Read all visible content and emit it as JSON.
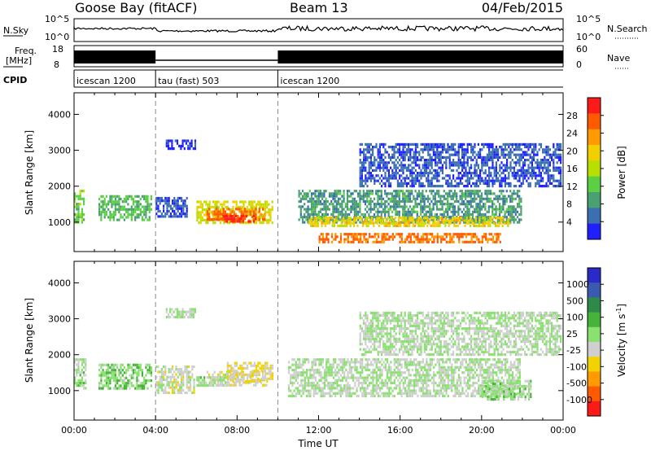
{
  "header": {
    "station": "Goose Bay (fitACF)",
    "beam": "Beam 13",
    "date": "04/Feb/2015"
  },
  "summary": {
    "nsky_label": "N.Sky",
    "nsearch_label": "N.Search",
    "freq_label_1": "Freq.",
    "freq_label_2": "[MHz]",
    "nave_label": "Nave",
    "cpid_label": "CPID",
    "nsky_ticks": [
      "10^5",
      "10^0"
    ],
    "nsearch_ticks": [
      "10^5",
      "10^0"
    ],
    "freq_ticks": [
      "18",
      "8"
    ],
    "nave_ticks": [
      "60",
      "0"
    ],
    "cpid_segments": [
      {
        "label": "icescan 1200",
        "start": 0,
        "end": 4
      },
      {
        "label": "tau (fast) 503",
        "start": 4,
        "end": 10
      },
      {
        "label": "icescan 1200",
        "start": 10,
        "end": 24
      }
    ]
  },
  "power_colorbar": {
    "title": "Power [dB]",
    "ticks": [
      "28",
      "24",
      "20",
      "16",
      "12",
      "8",
      "4"
    ],
    "colors": [
      "#ff1a1a",
      "#ff5a00",
      "#ff9a00",
      "#f2d000",
      "#b7e000",
      "#5bd044",
      "#4aa070",
      "#3a70b0",
      "#2020ff"
    ]
  },
  "velocity_colorbar": {
    "title": "Velocity [m s",
    "title_sup": "-1",
    "title_end": "]",
    "ticks": [
      "1000",
      "500",
      "100",
      "25",
      "-25",
      "-100",
      "-500",
      "-1000"
    ],
    "colors": [
      "#2a2ac8",
      "#3a5ab0",
      "#2f8a4a",
      "#46b43a",
      "#8ae070",
      "#cfcfcf",
      "#f2d200",
      "#ff9a00",
      "#ff5a00",
      "#ff1a1a"
    ]
  },
  "chart_data": [
    {
      "type": "heatmap",
      "panel": "power",
      "xlabel": "",
      "ylabel": "Slant Range [km]",
      "xlim": [
        0,
        24
      ],
      "ylim": [
        180,
        4600
      ],
      "ytick_labels": [
        "1000",
        "2000",
        "3000",
        "4000"
      ],
      "cpid_boundaries": [
        4,
        10
      ],
      "regions": [
        {
          "x0": 0.0,
          "x1": 0.6,
          "y0": 950,
          "y1": 1900,
          "v": 14
        },
        {
          "x0": 1.2,
          "x1": 3.9,
          "y0": 1000,
          "y1": 1750,
          "v": 12
        },
        {
          "x0": 4.0,
          "x1": 5.6,
          "y0": 1050,
          "y1": 1700,
          "v": 6
        },
        {
          "x0": 6.0,
          "x1": 9.8,
          "y0": 900,
          "y1": 1600,
          "v": 18
        },
        {
          "x0": 6.5,
          "x1": 9.4,
          "y0": 1000,
          "y1": 1400,
          "v": 26
        },
        {
          "x0": 7.2,
          "x1": 9.0,
          "y0": 950,
          "y1": 1200,
          "v": 30
        },
        {
          "x0": 11.0,
          "x1": 22.0,
          "y0": 900,
          "y1": 1900,
          "v": 10
        },
        {
          "x0": 11.5,
          "x1": 21.5,
          "y0": 850,
          "y1": 1150,
          "v": 20
        },
        {
          "x0": 12.0,
          "x1": 21.0,
          "y0": 400,
          "y1": 700,
          "v": 26
        },
        {
          "x0": 4.5,
          "x1": 6.0,
          "y0": 3000,
          "y1": 3300,
          "v": 4
        },
        {
          "x0": 14.0,
          "x1": 24.0,
          "y0": 1900,
          "y1": 3200,
          "v": 6
        }
      ]
    },
    {
      "type": "heatmap",
      "panel": "velocity",
      "xlabel": "Time UT",
      "ylabel": "Slant Range [km]",
      "xlim": [
        0,
        24
      ],
      "ylim": [
        180,
        4600
      ],
      "ytick_labels": [
        "1000",
        "2000",
        "3000",
        "4000"
      ],
      "xtick_labels": [
        "00:00",
        "04:00",
        "08:00",
        "12:00",
        "16:00",
        "20:00",
        "00:00"
      ],
      "cpid_boundaries": [
        4,
        10
      ],
      "regions": [
        {
          "x0": 0.0,
          "x1": 0.7,
          "y0": 1000,
          "y1": 1900,
          "v": 50
        },
        {
          "x0": 1.2,
          "x1": 3.9,
          "y0": 1000,
          "y1": 1750,
          "v": 150
        },
        {
          "x0": 4.0,
          "x1": 6.0,
          "y0": 900,
          "y1": 1700,
          "v": -80
        },
        {
          "x0": 6.5,
          "x1": 9.5,
          "y0": 1050,
          "y1": 1550,
          "v": -150
        },
        {
          "x0": 6.0,
          "x1": 7.5,
          "y0": 1100,
          "y1": 1400,
          "v": 80
        },
        {
          "x0": 7.5,
          "x1": 9.8,
          "y0": 1200,
          "y1": 1800,
          "v": -200
        },
        {
          "x0": 10.5,
          "x1": 22.0,
          "y0": 800,
          "y1": 1900,
          "v": 0
        },
        {
          "x0": 20.0,
          "x1": 22.5,
          "y0": 700,
          "y1": 1300,
          "v": 80
        },
        {
          "x0": 4.5,
          "x1": 6.0,
          "y0": 3000,
          "y1": 3300,
          "v": 0
        },
        {
          "x0": 14.0,
          "x1": 24.0,
          "y0": 1900,
          "y1": 3200,
          "v": 0
        }
      ]
    }
  ]
}
